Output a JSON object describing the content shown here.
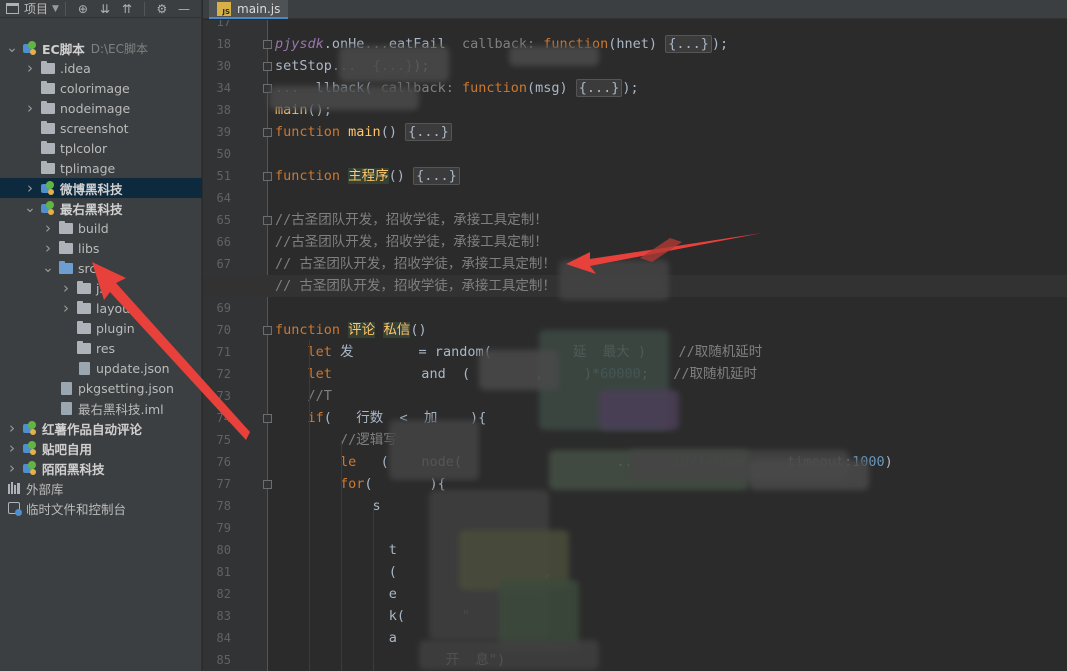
{
  "project_panel": {
    "view_label": "项目",
    "tree": [
      {
        "depth": 0,
        "arrow": "down",
        "icon": "module",
        "label": "EC脚本",
        "path": "D:\\EC脚本",
        "bold": true
      },
      {
        "depth": 1,
        "arrow": "right",
        "icon": "folder",
        "label": ".idea"
      },
      {
        "depth": 1,
        "arrow": "none",
        "icon": "folder",
        "label": "colorimage"
      },
      {
        "depth": 1,
        "arrow": "right",
        "icon": "folder",
        "label": "nodeimage"
      },
      {
        "depth": 1,
        "arrow": "none",
        "icon": "folder",
        "label": "screenshot"
      },
      {
        "depth": 1,
        "arrow": "none",
        "icon": "folder",
        "label": "tplcolor"
      },
      {
        "depth": 1,
        "arrow": "none",
        "icon": "folder",
        "label": "tplimage"
      },
      {
        "depth": 1,
        "arrow": "right",
        "icon": "module",
        "label": "微博黑科技",
        "bold": true,
        "selected": true
      },
      {
        "depth": 1,
        "arrow": "down",
        "icon": "module",
        "label": "最右黑科技",
        "bold": true
      },
      {
        "depth": 2,
        "arrow": "right",
        "icon": "folder",
        "label": "build"
      },
      {
        "depth": 2,
        "arrow": "right",
        "icon": "folder",
        "label": "libs"
      },
      {
        "depth": 2,
        "arrow": "down",
        "icon": "folder-blue",
        "label": "src"
      },
      {
        "depth": 3,
        "arrow": "right",
        "icon": "folder",
        "label": "js"
      },
      {
        "depth": 3,
        "arrow": "right",
        "icon": "folder",
        "label": "layout"
      },
      {
        "depth": 3,
        "arrow": "none",
        "icon": "folder",
        "label": "plugin"
      },
      {
        "depth": 3,
        "arrow": "none",
        "icon": "folder",
        "label": "res"
      },
      {
        "depth": 3,
        "arrow": "none",
        "icon": "file",
        "label": "update.json"
      },
      {
        "depth": 2,
        "arrow": "none",
        "icon": "file",
        "label": "pkgsetting.json"
      },
      {
        "depth": 2,
        "arrow": "none",
        "icon": "file",
        "label": "最右黑科技.iml"
      },
      {
        "depth": 0,
        "arrow": "right",
        "icon": "module",
        "label": "红薯作品自动评论",
        "bold": true
      },
      {
        "depth": 0,
        "arrow": "right",
        "icon": "module",
        "label": "贴吧自用",
        "bold": true
      },
      {
        "depth": 0,
        "arrow": "right",
        "icon": "module",
        "label": "陌陌黑科技",
        "bold": true
      },
      {
        "depth": -1,
        "arrow": "none",
        "icon": "library",
        "label": "外部库"
      },
      {
        "depth": -1,
        "arrow": "none",
        "icon": "scratch",
        "label": "临时文件和控制台"
      }
    ]
  },
  "editor": {
    "tab_label": "main.js",
    "current_line": "68",
    "lines": [
      {
        "n": "17",
        "html": ""
      },
      {
        "n": "18",
        "html": "<span class=\"it\">pjysdk</span>.onHe<span class=\"gr\">...</span>eatFail<span class=\"gr\">  callback:</span> <span class=\"kw\">function</span>(hnet) <span class=\"fold-box\">{...}</span>);"
      },
      {
        "n": "30",
        "html": "setStop<span class=\"gr\">...</span>  <span class=\"gr\">{...}</span>);"
      },
      {
        "n": "34",
        "html": "<span class=\"gr\">...</span>  llback(<span class=\"gr\"> callback:</span> <span class=\"kw\">function</span>(msg) <span class=\"fold-box\">{...}</span>);"
      },
      {
        "n": "38",
        "html": "<span class=\"fn\">main</span>();"
      },
      {
        "n": "39",
        "html": "<span class=\"kw\">function</span> <span class=\"fn\">main</span>() <span class=\"fold-box\">{...}</span>"
      },
      {
        "n": "50",
        "html": ""
      },
      {
        "n": "51",
        "html": "<span class=\"kw\">function</span> <span class=\"hl-ident\">主程序</span>() <span class=\"fold-box\">{...}</span>"
      },
      {
        "n": "64",
        "html": ""
      },
      {
        "n": "65",
        "html": "<span class=\"cm\">//古圣团队开发，招收学徒，承接工具定制！</span>"
      },
      {
        "n": "66",
        "html": "<span class=\"cm\">//古圣团队开发，招收学徒，承接工具定制！</span>"
      },
      {
        "n": "67",
        "html": "<span class=\"cm\">// 古圣团队开发，招收学徒，承接工具定制！</span>"
      },
      {
        "n": "68",
        "html": "<span class=\"cm\">// 古圣团队开发，招收学徒，承接工具定制！</span>"
      },
      {
        "n": "69",
        "html": ""
      },
      {
        "n": "70",
        "html": "<span class=\"kw\">function</span> <span class=\"hl-ident\">评论</span> <span class=\"hl-ident\">私信</span>()"
      },
      {
        "n": "71",
        "html": "    <span class=\"kw\">let</span> 发        = random(          延  最大 )    <span class=\"cm\">//取随机延时</span>"
      },
      {
        "n": "72",
        "html": "    <span class=\"kw\">let</span>           and  (        ,     )*<span class=\"num\">60000</span>;   <span class=\"cm\">//取随机延时</span>"
      },
      {
        "n": "73",
        "html": "    <span class=\"cm\">//T</span>"
      },
      {
        "n": "74",
        "html": "    <span class=\"kw\">if</span>(   行数  <  加    ){"
      },
      {
        "n": "75",
        "html": "        <span class=\"cm\">//逻辑写</span>"
      },
      {
        "n": "76",
        "html": "        <span class=\"kw\">le</span>   (    node(                   ...    id/tvName     timeout:<span class=\"num\">1000</span>)"
      },
      {
        "n": "77",
        "html": "        <span class=\"kw\">for</span>(       ){"
      },
      {
        "n": "78",
        "html": "            s"
      },
      {
        "n": "79",
        "html": "            "
      },
      {
        "n": "80",
        "html": "              t"
      },
      {
        "n": "81",
        "html": "              (                  ,"
      },
      {
        "n": "82",
        "html": "              e"
      },
      {
        "n": "83",
        "html": "              k(       <span class=\"str\">\"</span>"
      },
      {
        "n": "84",
        "html": "              a"
      },
      {
        "n": "85",
        "html": "                     开  息\")"
      }
    ]
  }
}
